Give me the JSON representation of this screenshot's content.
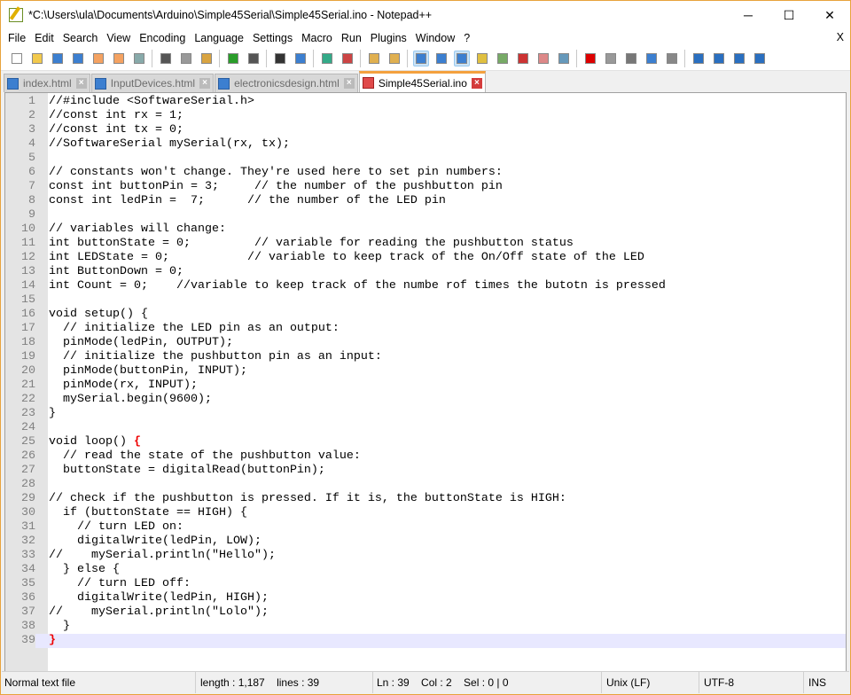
{
  "window": {
    "title": "*C:\\Users\\ula\\Documents\\Arduino\\Simple45Serial\\Simple45Serial.ino - Notepad++",
    "minimize": "─",
    "maximize": "☐",
    "close": "✕"
  },
  "menu": [
    "File",
    "Edit",
    "Search",
    "View",
    "Encoding",
    "Language",
    "Settings",
    "Macro",
    "Run",
    "Plugins",
    "Window",
    "?"
  ],
  "menu_close": "X",
  "toolbar": [
    "new",
    "open",
    "save",
    "save-all",
    "close",
    "close-all",
    "print",
    "|",
    "cut",
    "copy",
    "paste",
    "|",
    "undo",
    "redo",
    "|",
    "find",
    "replace",
    "|",
    "zoom-in",
    "zoom-out",
    "|",
    "sync-vertical",
    "sync-horizontal",
    "|",
    "word-wrap",
    "show-all-chars",
    "indent-guide",
    "udl",
    "doc-map",
    "function-list",
    "folder-workspace",
    "monitor",
    "|",
    "record-macro",
    "stop-record",
    "play-macro",
    "run-macro-multiple",
    "save-macro",
    "|",
    "first",
    "up",
    "down",
    "last"
  ],
  "tabs": [
    {
      "label": "index.html",
      "active": false
    },
    {
      "label": "InputDevices.html",
      "active": false
    },
    {
      "label": "electronicsdesign.html",
      "active": false
    },
    {
      "label": "Simple45Serial.ino",
      "active": true
    }
  ],
  "code": [
    "//#include <SoftwareSerial.h>",
    "//const int rx = 1;",
    "//const int tx = 0;",
    "//SoftwareSerial mySerial(rx, tx);",
    "",
    "// constants won't change. They're used here to set pin numbers:",
    "const int buttonPin = 3;     // the number of the pushbutton pin",
    "const int ledPin =  7;      // the number of the LED pin",
    "",
    "// variables will change:",
    "int buttonState = 0;         // variable for reading the pushbutton status",
    "int LEDState = 0;           // variable to keep track of the On/Off state of the LED",
    "int ButtonDown = 0;",
    "int Count = 0;    //variable to keep track of the numbe rof times the butotn is pressed",
    "",
    "void setup() {",
    "  // initialize the LED pin as an output:",
    "  pinMode(ledPin, OUTPUT);",
    "  // initialize the pushbutton pin as an input:",
    "  pinMode(buttonPin, INPUT);",
    "  pinMode(rx, INPUT);",
    "  mySerial.begin(9600);",
    "}",
    "",
    "void loop() {",
    "  // read the state of the pushbutton value:",
    "  buttonState = digitalRead(buttonPin);",
    "",
    "// check if the pushbutton is pressed. If it is, the buttonState is HIGH:",
    "  if (buttonState == HIGH) {",
    "    // turn LED on:",
    "    digitalWrite(ledPin, LOW);",
    "//    mySerial.println(\"Hello\");",
    "  } else {",
    "    // turn LED off:",
    "    digitalWrite(ledPin, HIGH);",
    "//    mySerial.println(\"Lolo\");",
    "  }",
    "}"
  ],
  "current_line": 39,
  "status": {
    "type": "Normal text file",
    "length": "length : 1,187    lines : 39",
    "position": "Ln : 39    Col : 2    Sel : 0 | 0",
    "eol": "Unix (LF)",
    "encoding": "UTF-8",
    "mode": "INS"
  }
}
